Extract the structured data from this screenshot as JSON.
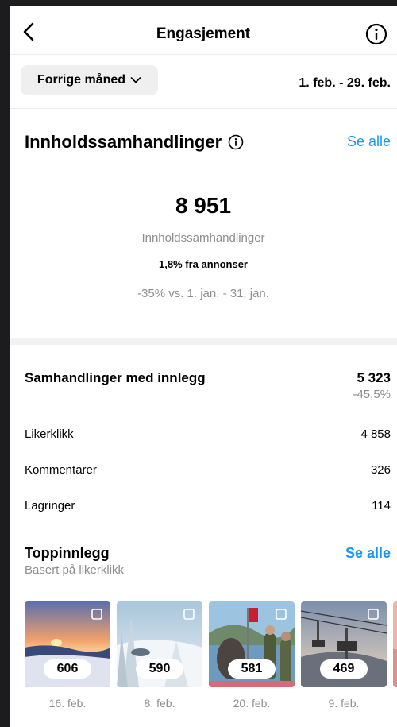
{
  "header": {
    "title": "Engasjement",
    "back_icon": "chevron-left-icon",
    "info_icon": "info-circle-icon"
  },
  "filter": {
    "period_label": "Forrige måned",
    "date_range": "1. feb. - 29. feb."
  },
  "content_interactions": {
    "title": "Innholdssamhandlinger",
    "see_all": "Se alle",
    "total": "8 951",
    "label": "Innholdssamhandlinger",
    "ads_note": "1,8% fra annonser",
    "comparison": "-35% vs. 1. jan. - 31. jan."
  },
  "post_interactions": {
    "title": "Samhandlinger med innlegg",
    "total": "5 323",
    "change": "-45,5%",
    "rows": [
      {
        "label": "Likerklikk",
        "value": "4 858"
      },
      {
        "label": "Kommentarer",
        "value": "326"
      },
      {
        "label": "Lagringer",
        "value": "114"
      }
    ]
  },
  "top_posts": {
    "title": "Toppinnlegg",
    "subtitle": "Basert på likerklikk",
    "see_all": "Se alle",
    "posts": [
      {
        "count": "606",
        "date": "16. feb."
      },
      {
        "count": "590",
        "date": "8. feb."
      },
      {
        "count": "581",
        "date": "20. feb."
      },
      {
        "count": "469",
        "date": "9. feb."
      }
    ]
  },
  "colors": {
    "link": "#1e96e8",
    "muted": "#8e8e8e",
    "frame": "#1c1c1e"
  }
}
